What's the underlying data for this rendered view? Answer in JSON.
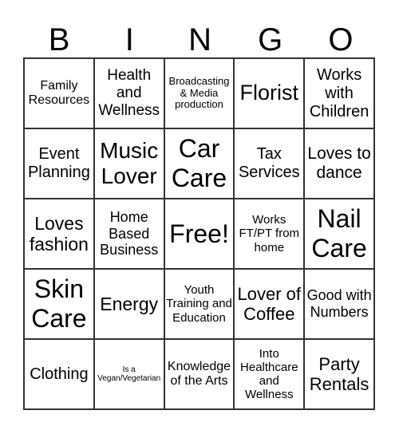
{
  "header": {
    "letters": [
      "B",
      "I",
      "N",
      "G",
      "O"
    ]
  },
  "cells": [
    {
      "text": "Family Resources",
      "size": 16
    },
    {
      "text": "Health and Wellness",
      "size": 19
    },
    {
      "text": "Broadcasting & Media production",
      "size": 13
    },
    {
      "text": "Florist",
      "size": 27
    },
    {
      "text": "Works with Children",
      "size": 20
    },
    {
      "text": "Event Planning",
      "size": 20
    },
    {
      "text": "Music Lover",
      "size": 28
    },
    {
      "text": "Car Care",
      "size": 32
    },
    {
      "text": "Tax Services",
      "size": 20
    },
    {
      "text": "Loves to dance",
      "size": 21
    },
    {
      "text": "Loves fashion",
      "size": 23
    },
    {
      "text": "Home Based Business",
      "size": 18
    },
    {
      "text": "Free!",
      "size": 32
    },
    {
      "text": "Works FT/PT from home",
      "size": 15
    },
    {
      "text": "Nail Care",
      "size": 32
    },
    {
      "text": "Skin Care",
      "size": 32
    },
    {
      "text": "Energy",
      "size": 23
    },
    {
      "text": "Youth Training and Education",
      "size": 15
    },
    {
      "text": "Lover of Coffee",
      "size": 22
    },
    {
      "text": "Good with Numbers",
      "size": 18
    },
    {
      "text": "Clothing",
      "size": 20
    },
    {
      "text": "Is a Vegan/Vegetarian",
      "size": 10
    },
    {
      "text": "Knowledge of the Arts",
      "size": 16
    },
    {
      "text": "Into Healthcare and Wellness",
      "size": 15
    },
    {
      "text": "Party Rentals",
      "size": 22
    }
  ]
}
